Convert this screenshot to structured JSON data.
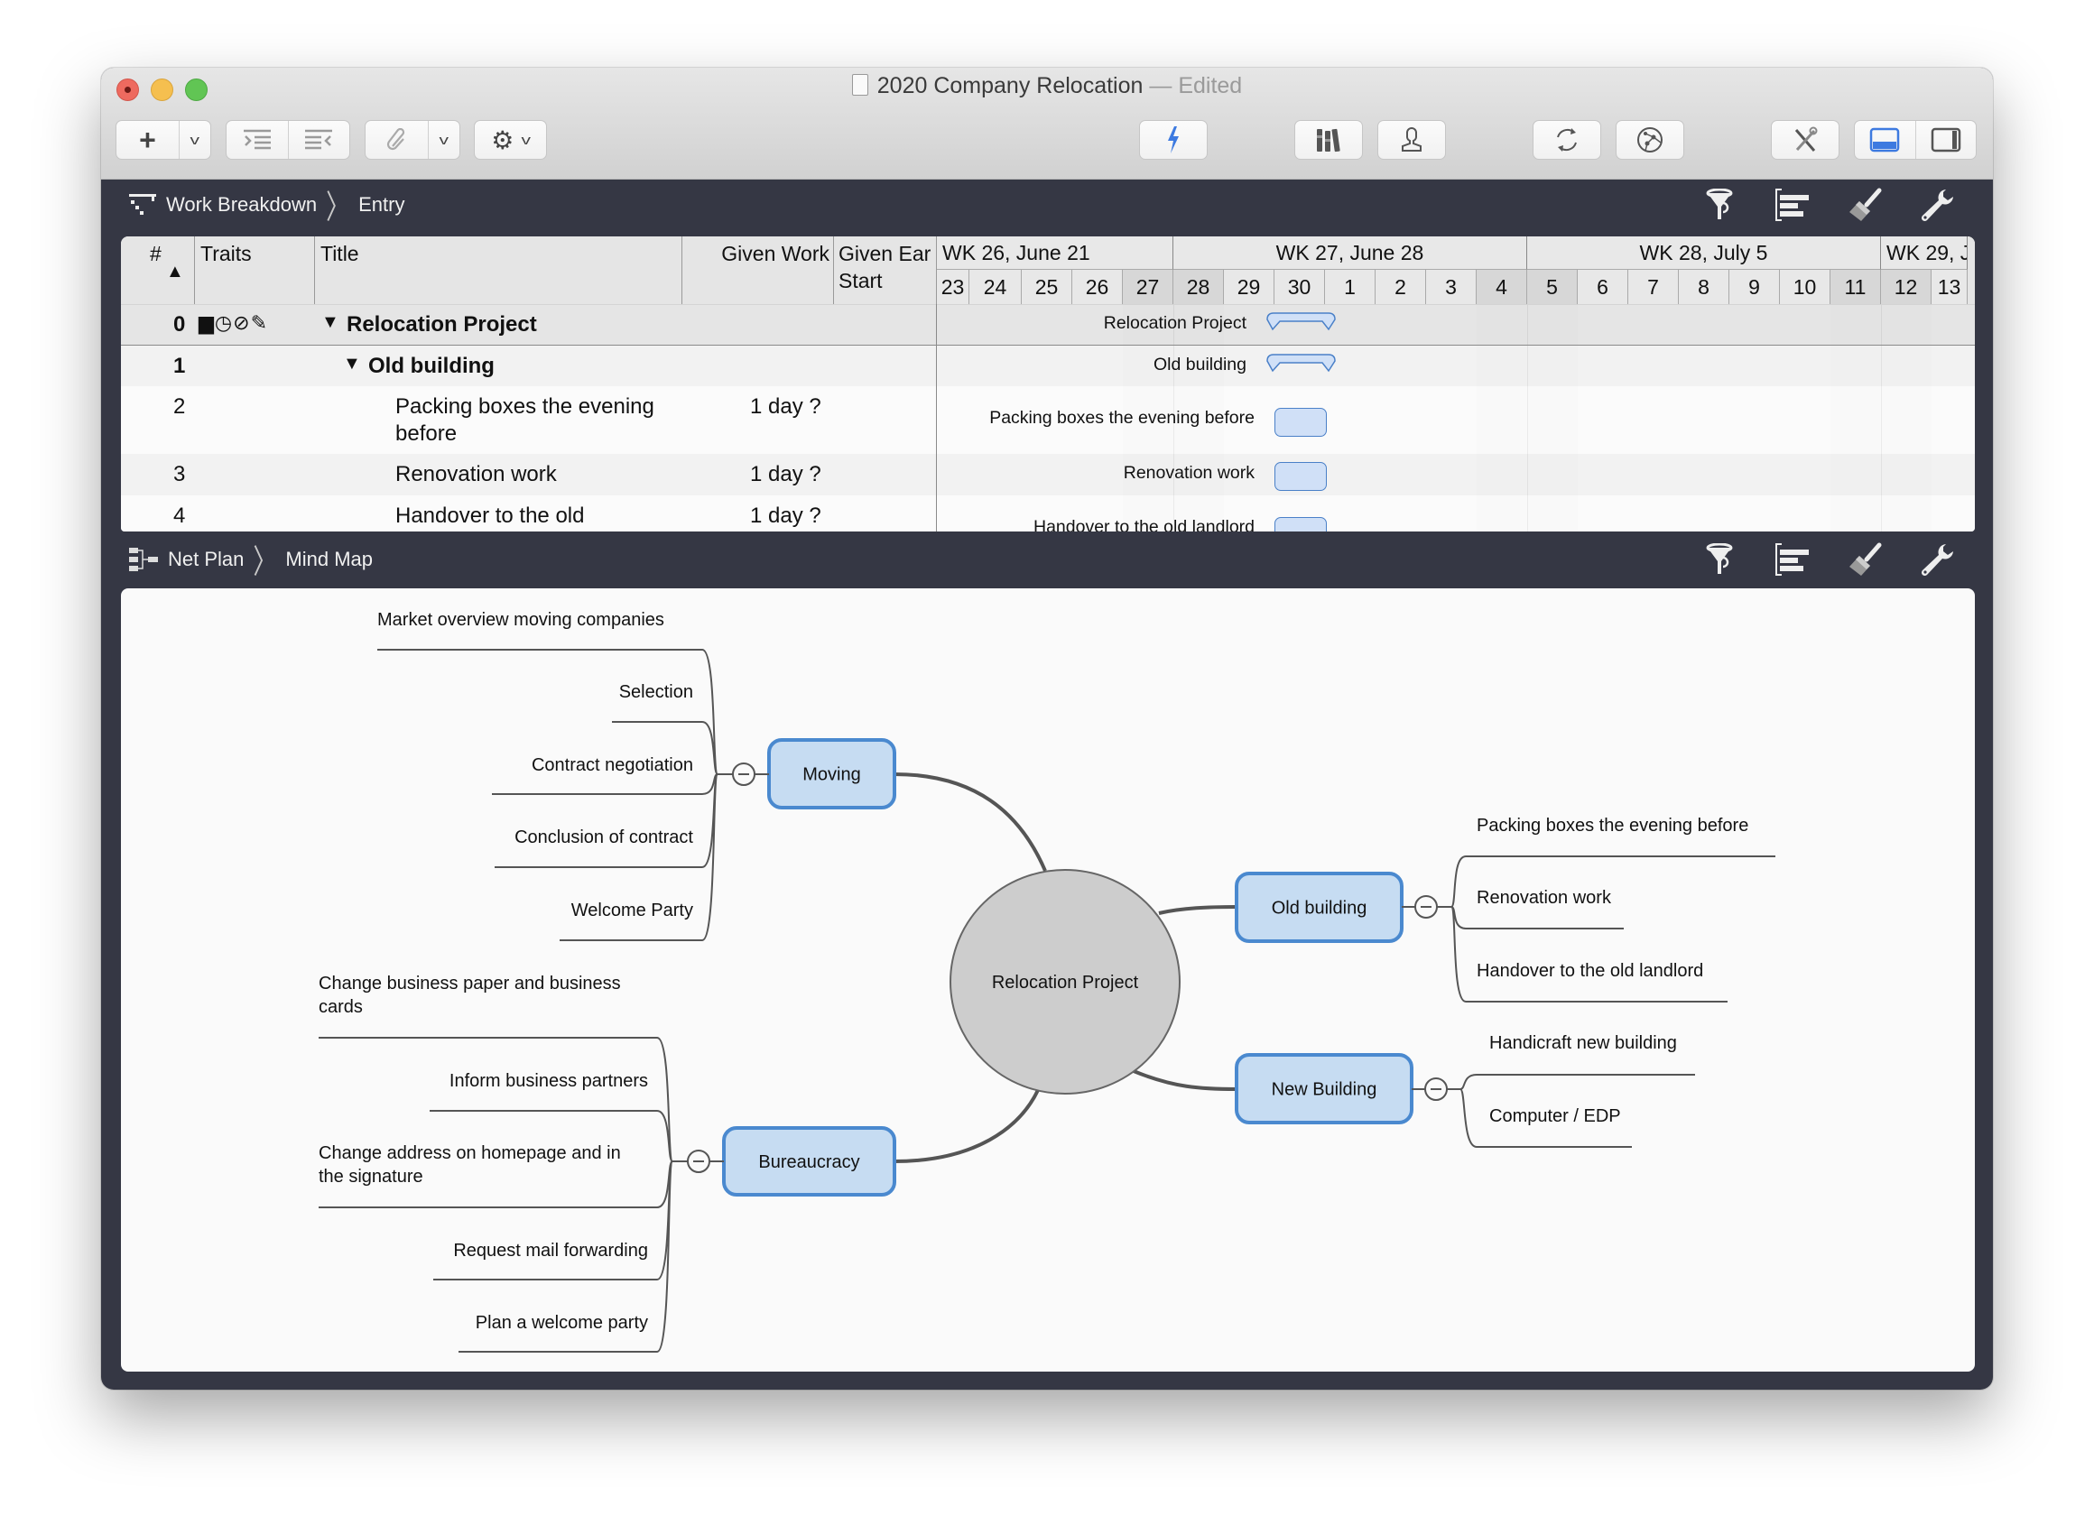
{
  "window": {
    "title": "2020 Company Relocation",
    "status": "— Edited",
    "colors": {
      "frame": "#353744",
      "accent": "#3d7ae0",
      "node_fill": "#c6dcf2",
      "node_stroke": "#4a89cf",
      "center_fill": "#cdcdcd"
    }
  },
  "toolbar": {
    "left_groups": [
      {
        "name": "add",
        "icons": [
          "plus-icon",
          "chevron-down-icon"
        ]
      },
      {
        "name": "indent",
        "icons": [
          "indent-icon",
          "outdent-icon"
        ]
      },
      {
        "name": "link",
        "icons": [
          "paperclip-icon",
          "chevron-down-icon"
        ]
      },
      {
        "name": "action",
        "icons": [
          "gear-icon",
          "chevron-down-icon"
        ]
      }
    ],
    "right_buttons": [
      "lightning-icon",
      "library-icon",
      "person-icon",
      "sync-icon",
      "network-icon",
      "tools-icon",
      "layout-bottom-icon",
      "layout-right-icon"
    ]
  },
  "top_view": {
    "breadcrumb": [
      "Work Breakdown",
      "Entry"
    ],
    "tools": [
      "filter-icon",
      "gantt-icon",
      "brush-icon",
      "wrench-icon"
    ],
    "columns": {
      "num": "#",
      "traits": "Traits",
      "title": "Title",
      "given_work": "Given Work",
      "given_early_start_1": "Given Ear",
      "given_early_start_2": "Start"
    },
    "weeks": [
      "WK 26, June 21",
      "WK 27, June 28",
      "WK 28, July 5",
      "WK 29, J"
    ],
    "days": [
      "23",
      "24",
      "25",
      "26",
      "27",
      "28",
      "29",
      "30",
      "1",
      "2",
      "3",
      "4",
      "5",
      "6",
      "7",
      "8",
      "9",
      "10",
      "11",
      "12",
      "13"
    ],
    "rows": [
      {
        "num": "0",
        "title": "Relocation Project",
        "work": "",
        "bold": true,
        "disclosure": true,
        "level": 0,
        "gantt_label": "Relocation Project",
        "bar": "summary"
      },
      {
        "num": "1",
        "title": "Old building",
        "work": "",
        "bold": true,
        "disclosure": true,
        "level": 1,
        "gantt_label": "Old building",
        "bar": "summary"
      },
      {
        "num": "2",
        "title": "Packing boxes the evening before",
        "title_l1": "Packing boxes the evening",
        "title_l2": "before",
        "work": "1 day ?",
        "level": 2,
        "gantt_label": "Packing boxes the evening before",
        "bar": "task"
      },
      {
        "num": "3",
        "title": "Renovation work",
        "work": "1 day ?",
        "level": 2,
        "gantt_label": "Renovation work",
        "bar": "task"
      },
      {
        "num": "4",
        "title": "Handover to the old",
        "work": "1 day ?",
        "level": 2,
        "gantt_label": "Handover to the old landlord",
        "bar": "task"
      }
    ]
  },
  "bottom_view": {
    "breadcrumb": [
      "Net Plan",
      "Mind Map"
    ],
    "tools": [
      "filter-icon",
      "gantt-icon",
      "brush-icon",
      "wrench-icon"
    ],
    "mind_map": {
      "center": "Relocation Project",
      "branches": [
        {
          "label": "Moving",
          "children": [
            "Market overview moving companies",
            "Selection",
            "Contract negotiation",
            "Conclusion of contract",
            "Welcome Party"
          ]
        },
        {
          "label": "Bureaucracy",
          "children": [
            "Change business paper and business cards",
            "Inform business partners",
            "Change address on homepage and in the signature",
            "Request mail forwarding",
            "Plan a welcome party"
          ]
        },
        {
          "label": "Old building",
          "children": [
            "Packing boxes the evening before",
            "Renovation work",
            "Handover to the old landlord"
          ]
        },
        {
          "label": "New Building",
          "children": [
            "Handicraft new building",
            "Computer / EDP"
          ]
        }
      ]
    }
  }
}
